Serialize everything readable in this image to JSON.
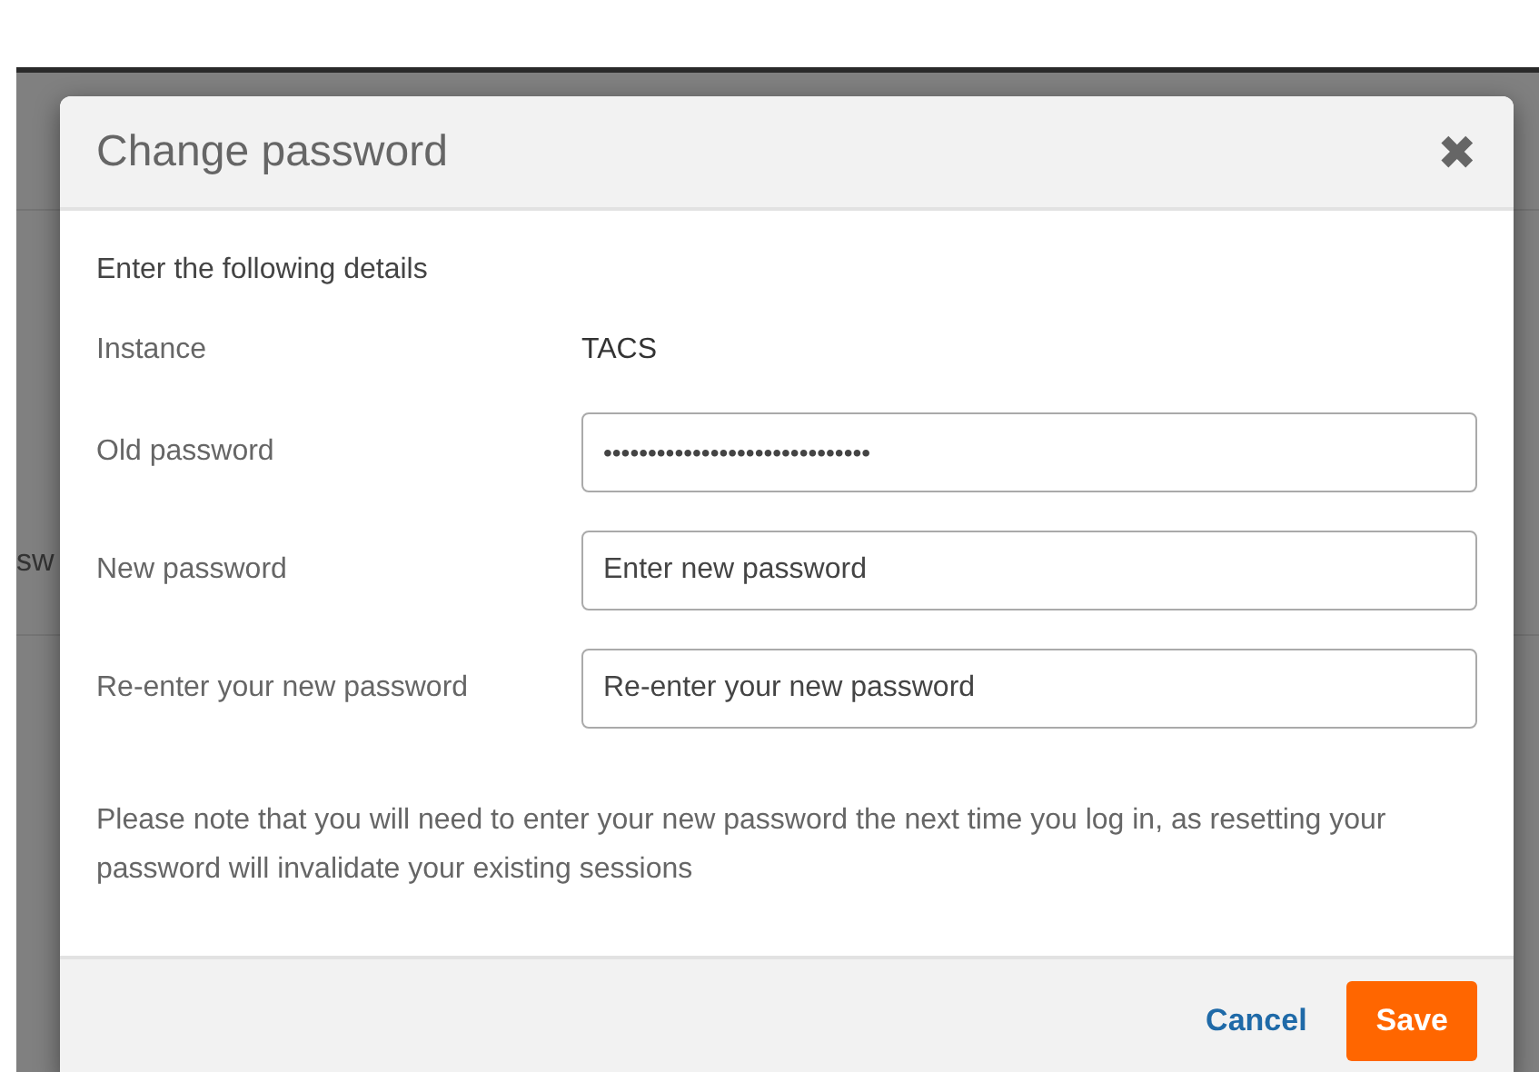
{
  "background_page": {
    "text": "sw"
  },
  "dialog": {
    "title": "Change password",
    "close_icon": "✖",
    "intro": "Enter the following details",
    "instance": {
      "label": "Instance",
      "value": "TACS"
    },
    "fields": [
      {
        "label": "Old password",
        "value": "••••••••••••••••••••••••••••••"
      },
      {
        "label": "New password",
        "placeholder": "Enter new password"
      },
      {
        "label": "Re-enter your new password",
        "placeholder": "Re-enter your new password"
      }
    ],
    "note": "Please note that you will need to enter your new password the next time you log in, as resetting your password will invalidate your existing sessions",
    "buttons": [
      {
        "label": "Cancel",
        "kind": "link"
      },
      {
        "label": "Save",
        "kind": "primary"
      }
    ]
  }
}
